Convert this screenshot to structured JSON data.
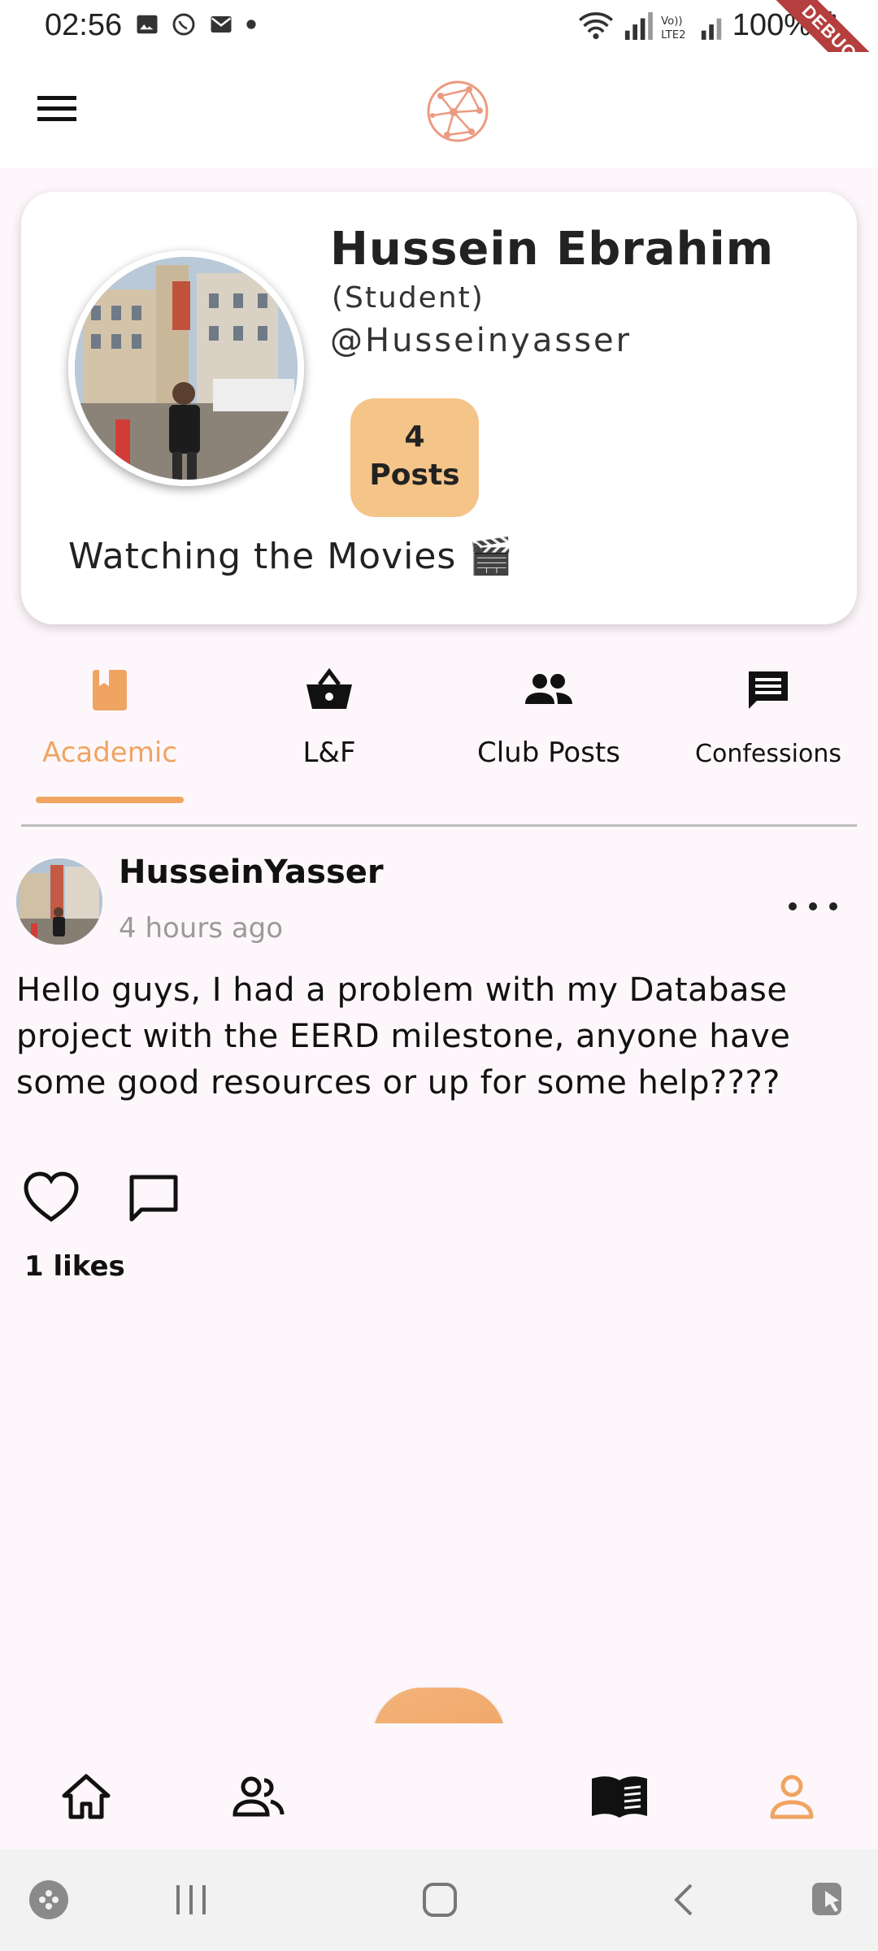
{
  "status_bar": {
    "time": "02:56",
    "battery": "100%",
    "debug_label": "DEBUG"
  },
  "profile": {
    "name": "Hussein Ebrahim",
    "role": "(Student)",
    "handle": "@Husseinyasser",
    "posts_count": "4",
    "posts_label": "Posts",
    "status": "Watching the Movies 🎬"
  },
  "tabs": [
    {
      "label": "Academic",
      "icon": "book-icon",
      "active": true
    },
    {
      "label": "L&F",
      "icon": "basket-icon",
      "active": false
    },
    {
      "label": "Club Posts",
      "icon": "group-icon",
      "active": false
    },
    {
      "label": "Confessions",
      "icon": "chat-icon",
      "active": false
    }
  ],
  "post": {
    "author": "HusseinYasser",
    "time": "4 hours ago",
    "body": "Hello guys, I had a problem with my Database project with the EERD milestone, anyone have some good resources or up for some help????",
    "likes": "1 likes"
  },
  "bottom_nav": [
    "home-icon",
    "people-icon",
    "search-icon",
    "reader-icon",
    "profile-icon"
  ],
  "colors": {
    "accent": "#f0a461",
    "badge": "#f5c489",
    "background": "#fdf7fb"
  }
}
